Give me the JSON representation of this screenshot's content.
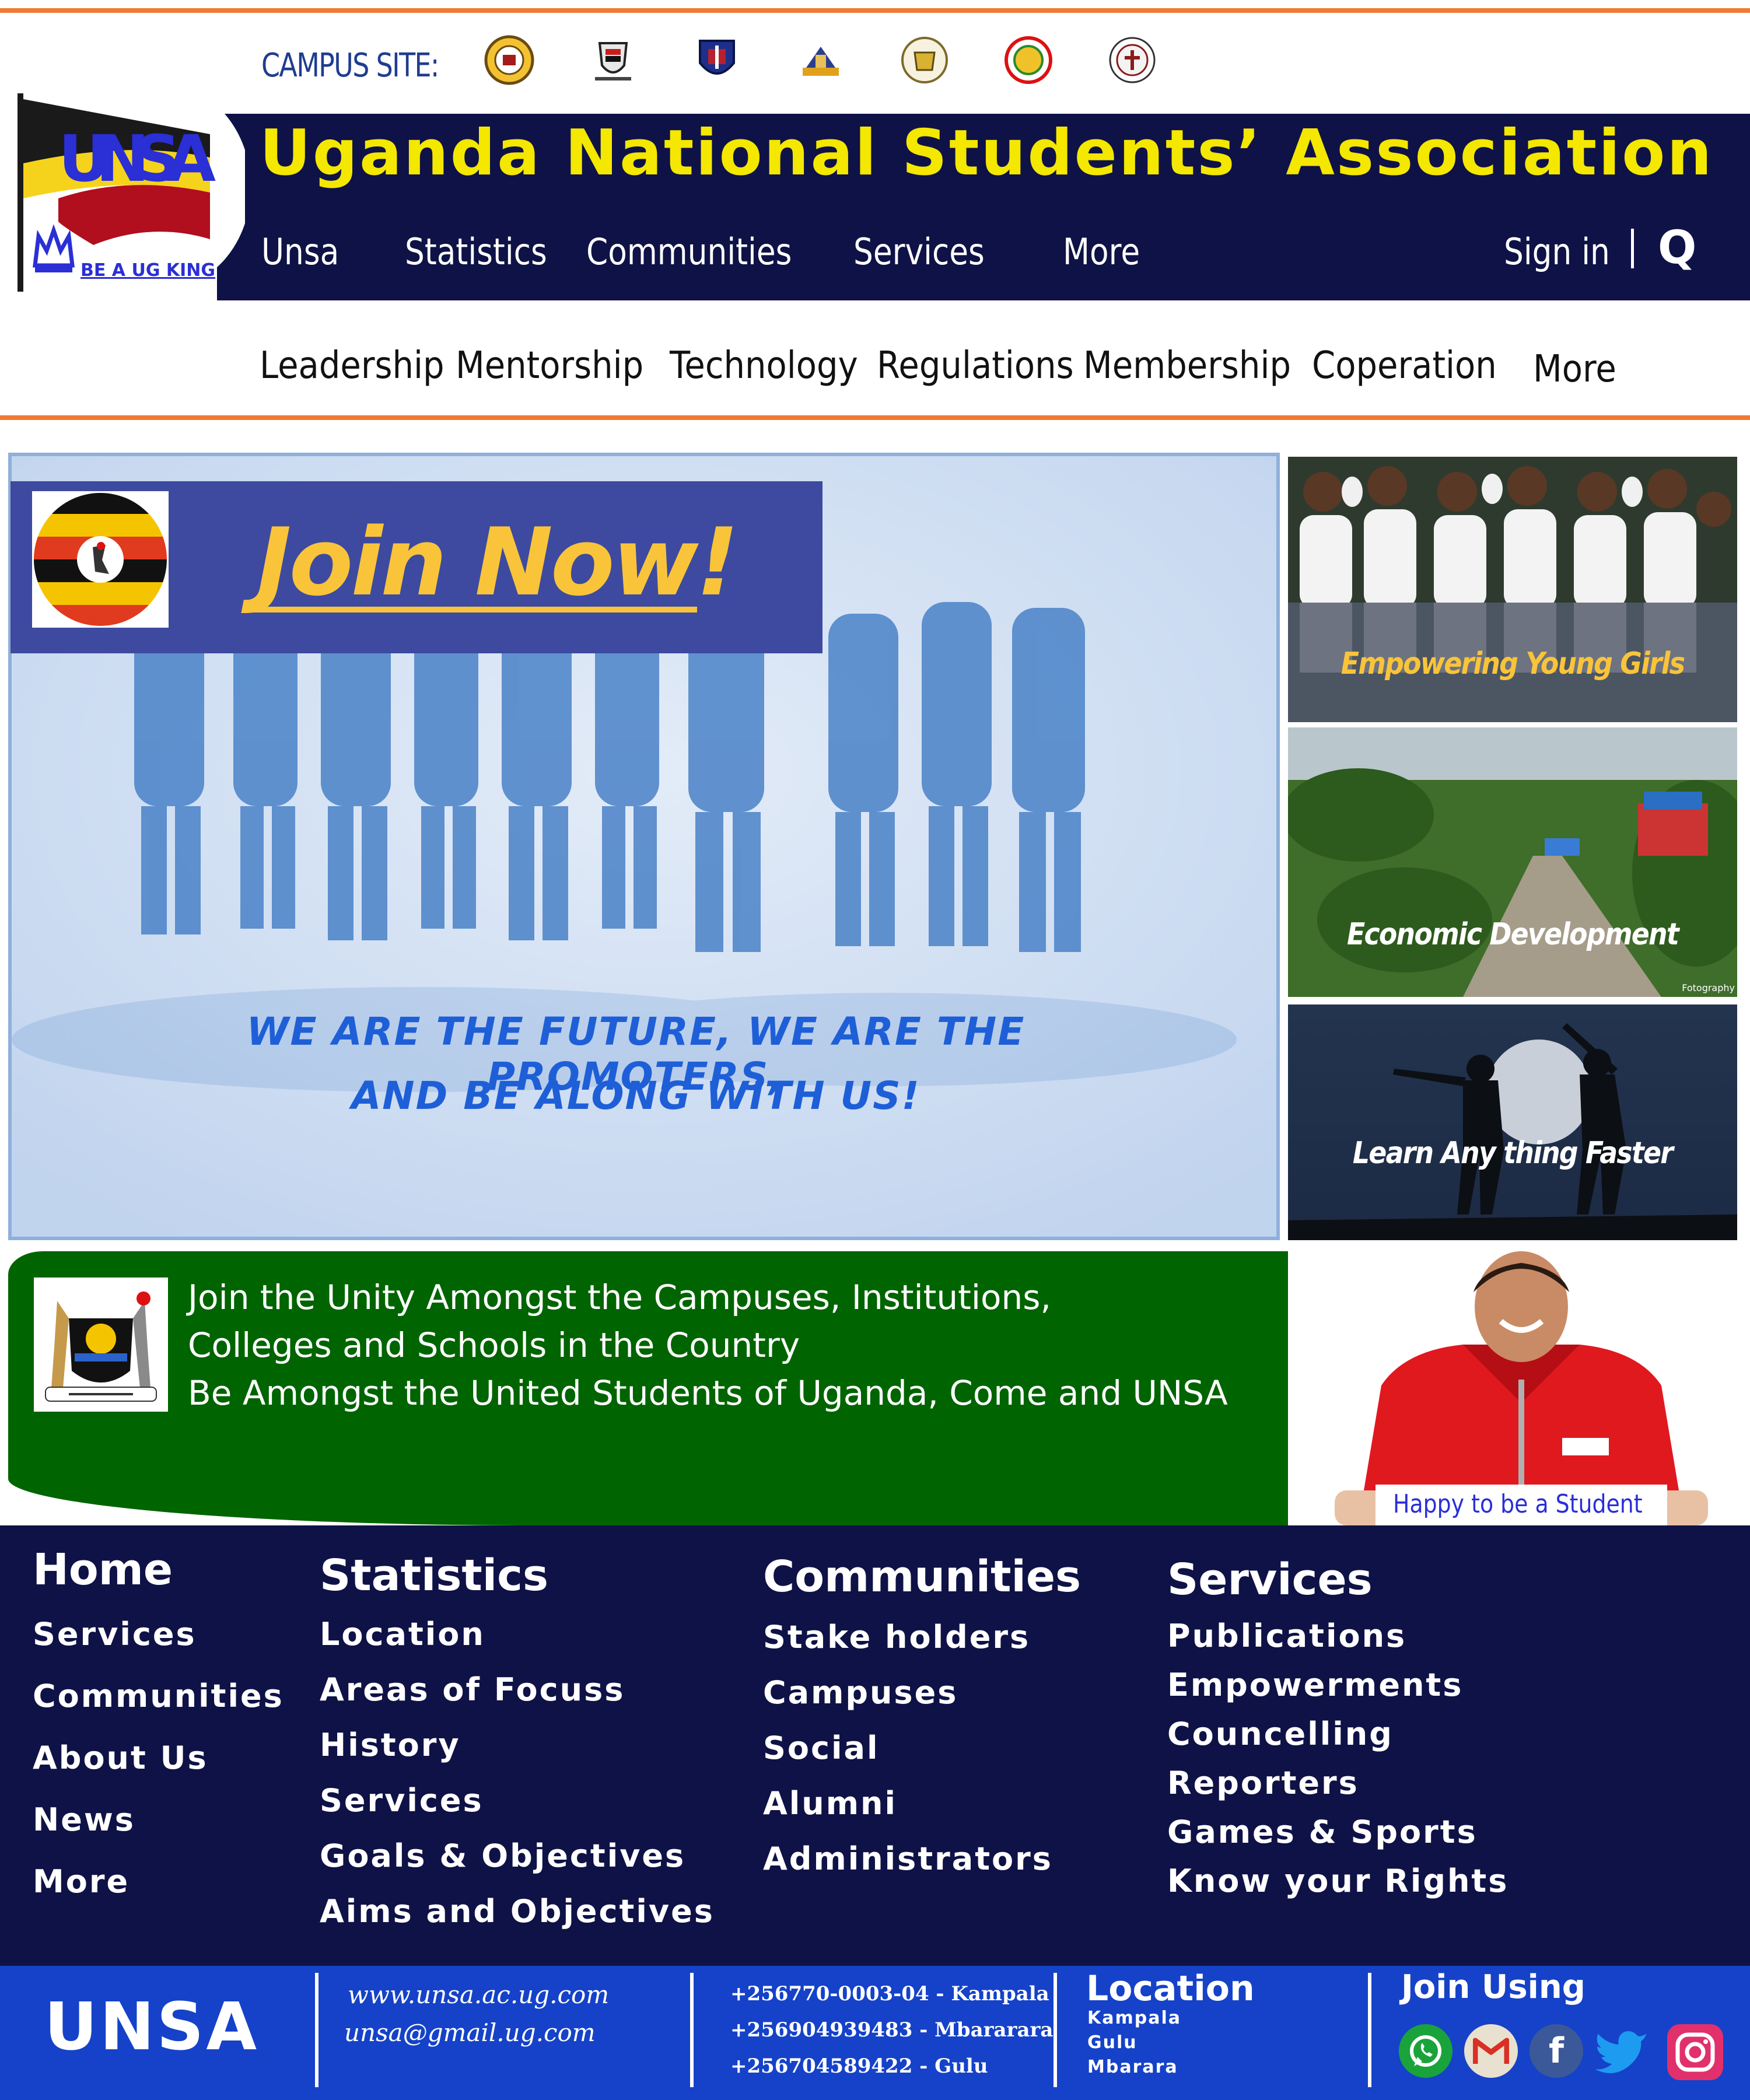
{
  "campus": {
    "label": "CAMPUS SITE:",
    "logos": [
      "campus-seal-1-icon",
      "campus-seal-2-icon",
      "campus-seal-3-icon",
      "campus-seal-4-icon",
      "campus-seal-5-icon",
      "campus-seal-6-icon",
      "campus-seal-7-icon"
    ]
  },
  "logo": {
    "text": "UNSA",
    "tagline": "BE A UG KING"
  },
  "header": {
    "title": "Uganda National Students’ Association",
    "nav": [
      "Unsa",
      "Statistics",
      "Communities",
      "Services",
      "More"
    ],
    "sign_in": "Sign in",
    "search_glyph": "Q"
  },
  "subnav": [
    "Leadership",
    "Mentorship",
    "Technology",
    "Regulations",
    "Membership",
    "Coperation",
    "More"
  ],
  "hero": {
    "join": "Join Now!",
    "tagline_line1": "WE ARE THE FUTURE, WE ARE THE PROMOTERS,",
    "tagline_line2": "AND BE ALONG WITH US!"
  },
  "side_images": [
    {
      "caption": "Empowering Young Girls"
    },
    {
      "caption": "Economic Development",
      "credit": "Fotography"
    },
    {
      "caption": "Learn Any thing Faster"
    }
  ],
  "unity": {
    "line1": "Join the Unity Amongst the Campuses, Institutions,",
    "line2": "Colleges and Schools in the Country",
    "line3": "Be Amongst the United Students of Uganda, Come and UNSA",
    "coat_motto": "FOR GOD AND MY COUNTRY"
  },
  "student": {
    "caption": "Happy to be a Student"
  },
  "footer": {
    "col1": {
      "heading": "Home",
      "links": [
        "Services",
        "Communities",
        "About Us",
        "News",
        "More"
      ]
    },
    "col2": {
      "heading": "Statistics",
      "links": [
        "Location",
        "Areas of Focuss",
        "History",
        "Services",
        "Goals & Objectives",
        "Aims and Objectives"
      ]
    },
    "col3": {
      "heading": "Communities",
      "links": [
        "Stake holders",
        "Campuses",
        "Social",
        "Alumni",
        "Administrators"
      ]
    },
    "col4": {
      "heading": "Services",
      "links": [
        "Publications",
        "Empowerments",
        "Councelling",
        "Reporters",
        "Games & Sports",
        "Know your Rights"
      ]
    }
  },
  "bottom": {
    "brand": "UNSA",
    "website": "www.unsa.ac.ug.com",
    "email": "unsa@gmail.ug.com",
    "phones": [
      "+256770-0003-04 - Kampala",
      "+256904939483 - Mbararara",
      "+256704589422 - Gulu"
    ],
    "location_heading": "Location",
    "locations": [
      "Kampala",
      "Gulu",
      "Mbarara"
    ],
    "join_heading": "Join Using",
    "social": [
      "whatsapp-icon",
      "gmail-icon",
      "facebook-icon",
      "twitter-icon",
      "instagram-icon"
    ]
  },
  "colors": {
    "navy": "#0f1246",
    "accent_orange": "#ef7a33",
    "title_yellow": "#f4e700",
    "join_gold": "#f9c43a",
    "tagline_blue": "#1e5fd8",
    "green": "#006400",
    "bottom_blue": "#1542c8"
  }
}
